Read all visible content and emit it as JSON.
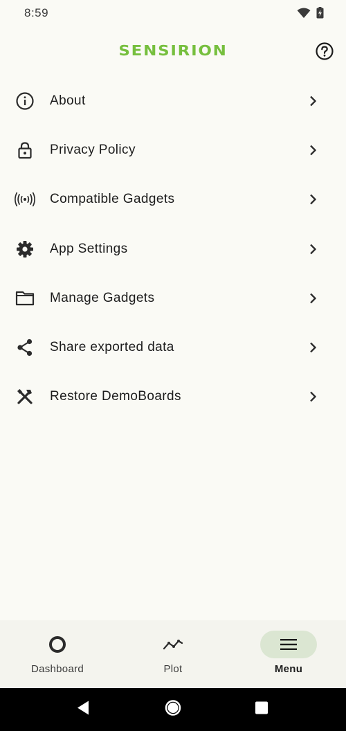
{
  "status_bar": {
    "time": "8:59",
    "icons": [
      "wifi-icon",
      "battery-charging-icon"
    ]
  },
  "header": {
    "logo_text": "SENSIRION",
    "help_icon": "help-circle-icon",
    "brand_color": "#76bf3e"
  },
  "menu": {
    "items": [
      {
        "label": "About",
        "icon": "info-icon"
      },
      {
        "label": "Privacy Policy",
        "icon": "lock-icon"
      },
      {
        "label": "Compatible Gadgets",
        "icon": "broadcast-icon"
      },
      {
        "label": "App Settings",
        "icon": "gear-icon"
      },
      {
        "label": "Manage Gadgets",
        "icon": "folder-icon"
      },
      {
        "label": "Share exported data",
        "icon": "share-icon"
      },
      {
        "label": "Restore DemoBoards",
        "icon": "tools-icon"
      }
    ]
  },
  "bottom_nav": {
    "items": [
      {
        "label": "Dashboard",
        "icon": "ring-icon",
        "active": false
      },
      {
        "label": "Plot",
        "icon": "line-chart-icon",
        "active": false
      },
      {
        "label": "Menu",
        "icon": "hamburger-icon",
        "active": true
      }
    ],
    "active_pill_color": "#dbe6d2"
  },
  "system_nav": {
    "buttons": [
      "back-icon",
      "home-icon",
      "recents-icon"
    ]
  }
}
